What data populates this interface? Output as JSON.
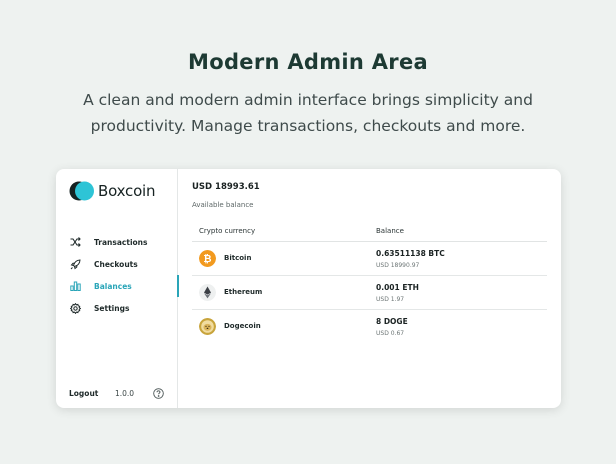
{
  "hero": {
    "title": "Modern Admin Area",
    "subtitle": "A clean and modern admin interface brings simplicity and productivity. Manage transactions, checkouts and more."
  },
  "app": {
    "brand": "Boxcoin",
    "brand_color": "#2ec4d6",
    "accent_color": "#2aa5b8"
  },
  "sidebar": {
    "items": [
      {
        "label": "Transactions",
        "icon": "shuffle-icon",
        "active": false
      },
      {
        "label": "Checkouts",
        "icon": "rocket-icon",
        "active": false
      },
      {
        "label": "Balances",
        "icon": "bar-chart-icon",
        "active": true
      },
      {
        "label": "Settings",
        "icon": "gear-icon",
        "active": false
      }
    ],
    "logout": "Logout",
    "version": "1.0.0",
    "help_icon": "help-circle-icon"
  },
  "balance": {
    "amount": "USD 18993.61",
    "label": "Available balance"
  },
  "table": {
    "headers": [
      "Crypto currency",
      "Balance"
    ],
    "rows": [
      {
        "name": "Bitcoin",
        "icon": "bitcoin-icon",
        "amount": "0.63511138 BTC",
        "usd": "USD 18990.97"
      },
      {
        "name": "Ethereum",
        "icon": "ethereum-icon",
        "amount": "0.001 ETH",
        "usd": "USD 1.97"
      },
      {
        "name": "Dogecoin",
        "icon": "dogecoin-icon",
        "amount": "8 DOGE",
        "usd": "USD 0.67"
      }
    ]
  }
}
